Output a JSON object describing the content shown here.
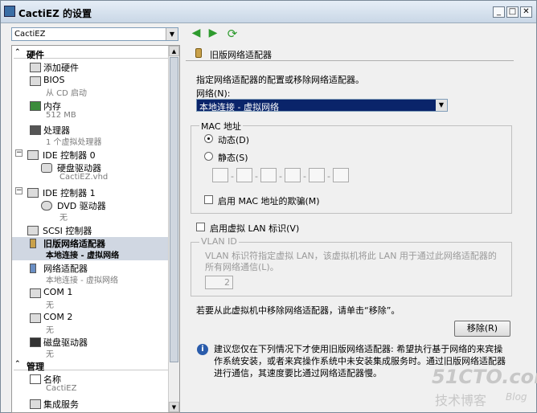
{
  "window": {
    "title": "CactiEZ 的设置",
    "min": "_",
    "max": "□",
    "close": "✕"
  },
  "vm_select": {
    "value": "CactiEZ"
  },
  "nav": {
    "back": "◀",
    "forward": "▶",
    "refresh": "⟳"
  },
  "sidebar": {
    "hardware_heading": "硬件",
    "management_heading": "管理",
    "items": [
      {
        "name": "添加硬件",
        "sub": ""
      },
      {
        "name": "BIOS",
        "sub": "从 CD 启动"
      },
      {
        "name": "内存",
        "sub": "512 MB"
      },
      {
        "name": "处理器",
        "sub": "1 个虚拟处理器"
      },
      {
        "name": "IDE 控制器 0",
        "sub": ""
      },
      {
        "name": "硬盘驱动器",
        "sub": "CactiEZ.vhd"
      },
      {
        "name": "IDE 控制器 1",
        "sub": ""
      },
      {
        "name": "DVD 驱动器",
        "sub": "无"
      },
      {
        "name": "SCSI 控制器",
        "sub": ""
      },
      {
        "name": "旧版网络适配器",
        "sub": "本地连接 - 虚拟网络"
      },
      {
        "name": "网络适配器",
        "sub": "本地连接 - 虚拟网络"
      },
      {
        "name": "COM 1",
        "sub": "无"
      },
      {
        "name": "COM 2",
        "sub": "无"
      },
      {
        "name": "磁盘驱动器",
        "sub": "无"
      },
      {
        "name": "名称",
        "sub": "CactiEZ"
      },
      {
        "name": "集成服务",
        "sub": ""
      }
    ]
  },
  "panel": {
    "heading": "旧版网络适配器",
    "description": "指定网络适配器的配置或移除网络适配器。",
    "network_label": "网络(N):",
    "network_value": "本地连接 - 虚拟网络",
    "mac_group": "MAC 地址",
    "dynamic": "动态(D)",
    "static": "静态(S)",
    "mac_spoof": "启用 MAC 地址的欺骗(M)",
    "vlan_enable": "启用虚拟 LAN 标识(V)",
    "vlan_group": "VLAN ID",
    "vlan_desc": "VLAN 标识符指定虚拟 LAN，该虚拟机将此 LAN 用于通过此网络适配器的所有网络通信(L)。",
    "vlan_value": "2",
    "remove_hint": "若要从此虚拟机中移除网络适配器，请单击“移除”。",
    "remove_button": "移除(R)",
    "info": "建议您仅在下列情况下才使用旧版网络适配器: 希望执行基于网络的来宾操作系统安装，或者来宾操作系统中未安装集成服务时。通过旧版网络适配器进行通信，其速度要比通过网络适配器慢。"
  },
  "watermark": {
    "site": "51CTO.com",
    "cn": "技术博客",
    "en": "Blog"
  }
}
